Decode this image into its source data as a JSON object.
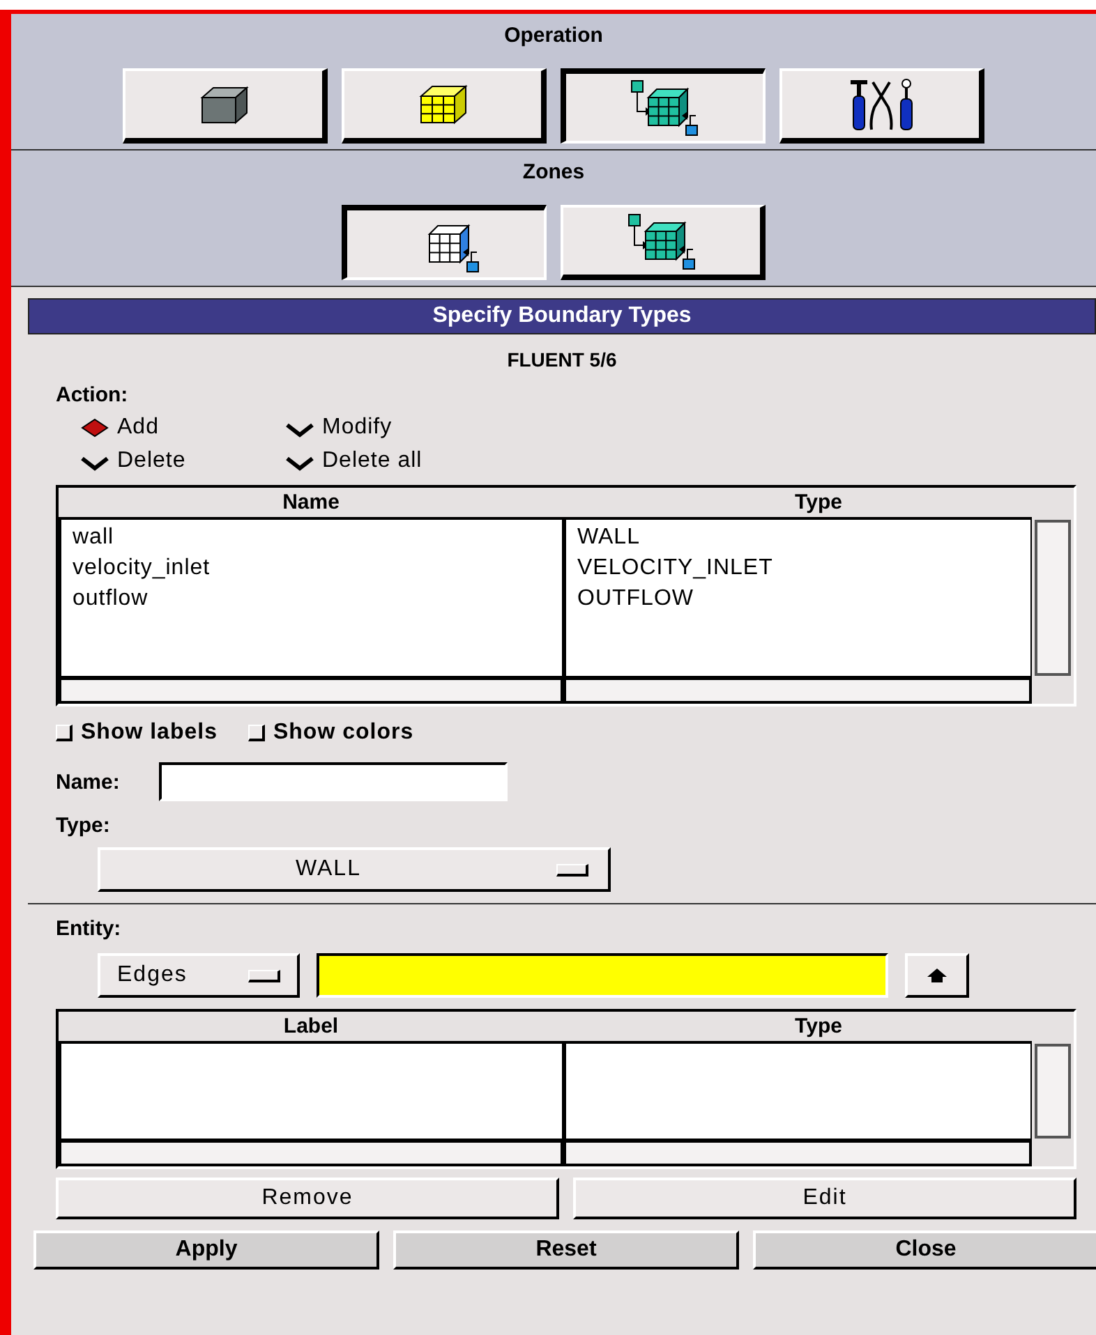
{
  "operation": {
    "title": "Operation",
    "buttons": [
      {
        "kind": "geometry",
        "selected": false
      },
      {
        "kind": "mesh",
        "selected": false
      },
      {
        "kind": "zones",
        "selected": true
      },
      {
        "kind": "tools",
        "selected": false
      }
    ]
  },
  "zones": {
    "title": "Zones",
    "buttons": [
      {
        "kind": "specify",
        "selected": true
      },
      {
        "kind": "zones",
        "selected": false
      }
    ]
  },
  "dialog": {
    "title": "Specify Boundary Types",
    "solver": "FLUENT 5/6",
    "action": {
      "label": "Action:",
      "options": [
        {
          "label": "Add",
          "selected": true
        },
        {
          "label": "Modify",
          "selected": false
        },
        {
          "label": "Delete",
          "selected": false
        },
        {
          "label": "Delete all",
          "selected": false
        }
      ]
    },
    "table": {
      "columns": [
        "Name",
        "Type"
      ],
      "rows": [
        [
          "wall",
          "WALL"
        ],
        [
          "velocity_inlet",
          "VELOCITY_INLET"
        ],
        [
          "outflow",
          "OUTFLOW"
        ]
      ]
    },
    "checkboxes": [
      {
        "label": "Show labels",
        "checked": false
      },
      {
        "label": "Show colors",
        "checked": false
      }
    ],
    "name_label": "Name:",
    "type_label": "Type:",
    "type_value": "WALL",
    "entity_label": "Entity:",
    "entity_value": "Edges",
    "entity_table": {
      "columns": [
        "Label",
        "Type"
      ]
    },
    "list_buttons": [
      "Remove",
      "Edit"
    ],
    "buttons": [
      "Apply",
      "Reset",
      "Close"
    ]
  }
}
